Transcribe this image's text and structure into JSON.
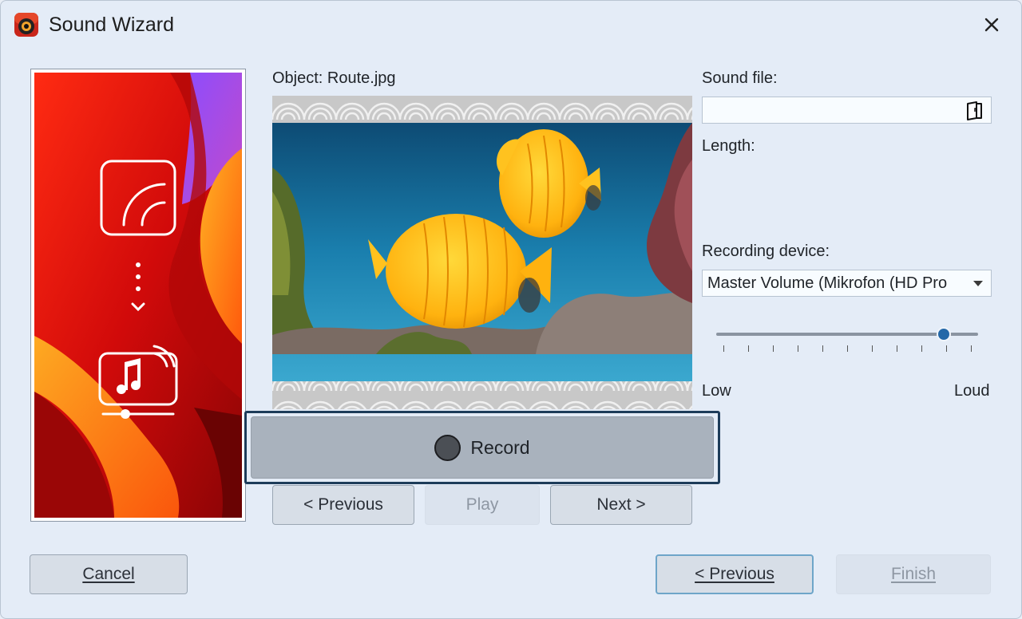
{
  "window": {
    "title": "Sound Wizard",
    "app_icon": "camera-app-icon",
    "close_icon": "close-icon"
  },
  "main": {
    "object_label": "Object: Route.jpg",
    "sound_file_label": "Sound file:",
    "sound_file_value": "",
    "length_label": "Length:",
    "recording_device_label": "Recording device:",
    "recording_device_value": "Master Volume (Mikrofon (HD Pro",
    "volume": {
      "low_label": "Low",
      "loud_label": "Loud",
      "level": 0.87,
      "ticks": 11
    },
    "record_label": "Record"
  },
  "playback": {
    "previous_label": "< Previous",
    "play_label": "Play",
    "next_label": "Next >"
  },
  "footer": {
    "cancel_label": "Cancel",
    "previous_label": "< Previous",
    "finish_label": "Finish"
  },
  "colors": {
    "accent": "#2468a8",
    "window_bg": "#e4ecf7"
  }
}
